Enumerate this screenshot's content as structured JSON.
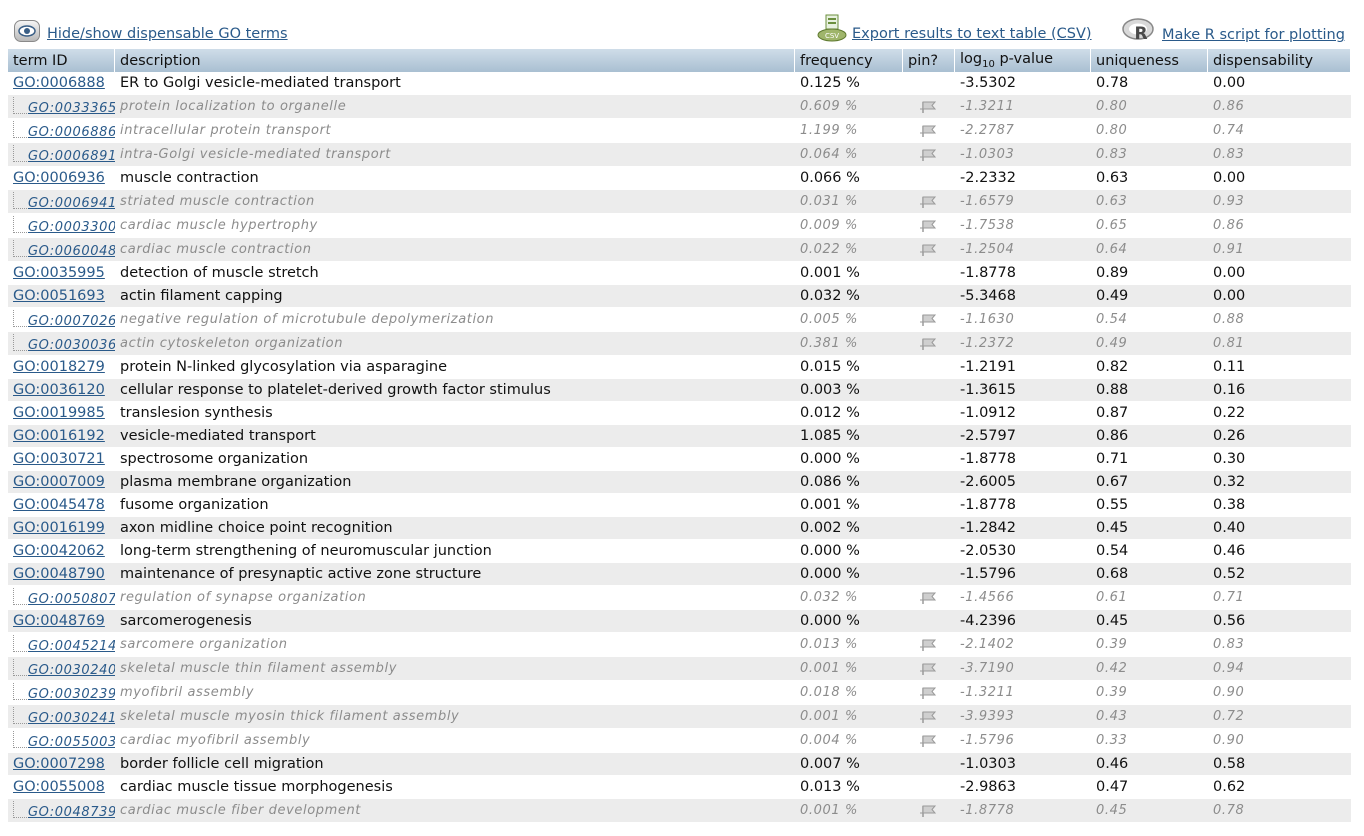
{
  "toolbar": {
    "hide_show_label": "Hide/show dispensable GO terms",
    "export_csv_label": "Export results to text table (CSV)",
    "r_script_label": "Make R script for plotting"
  },
  "table": {
    "headers": {
      "term_id": "term ID",
      "description": "description",
      "frequency": "frequency",
      "pin": "pin?",
      "pvalue_prefix": "log",
      "pvalue_sub": "10",
      "pvalue_suffix": " p-value",
      "uniqueness": "uniqueness",
      "dispensability": "dispensability"
    },
    "rows": [
      {
        "id": "GO:0006888",
        "desc": "ER to Golgi vesicle-mediated transport",
        "freq": "0.125 %",
        "pval": "-3.5302",
        "uniq": "0.78",
        "disp": "0.00",
        "sub": false
      },
      {
        "id": "GO:0033365",
        "desc": "protein localization to organelle",
        "freq": "0.609 %",
        "pval": "-1.3211",
        "uniq": "0.80",
        "disp": "0.86",
        "sub": true
      },
      {
        "id": "GO:0006886",
        "desc": "intracellular protein transport",
        "freq": "1.199 %",
        "pval": "-2.2787",
        "uniq": "0.80",
        "disp": "0.74",
        "sub": true
      },
      {
        "id": "GO:0006891",
        "desc": "intra-Golgi vesicle-mediated transport",
        "freq": "0.064 %",
        "pval": "-1.0303",
        "uniq": "0.83",
        "disp": "0.83",
        "sub": true
      },
      {
        "id": "GO:0006936",
        "desc": "muscle contraction",
        "freq": "0.066 %",
        "pval": "-2.2332",
        "uniq": "0.63",
        "disp": "0.00",
        "sub": false
      },
      {
        "id": "GO:0006941",
        "desc": "striated muscle contraction",
        "freq": "0.031 %",
        "pval": "-1.6579",
        "uniq": "0.63",
        "disp": "0.93",
        "sub": true
      },
      {
        "id": "GO:0003300",
        "desc": "cardiac muscle hypertrophy",
        "freq": "0.009 %",
        "pval": "-1.7538",
        "uniq": "0.65",
        "disp": "0.86",
        "sub": true
      },
      {
        "id": "GO:0060048",
        "desc": "cardiac muscle contraction",
        "freq": "0.022 %",
        "pval": "-1.2504",
        "uniq": "0.64",
        "disp": "0.91",
        "sub": true
      },
      {
        "id": "GO:0035995",
        "desc": "detection of muscle stretch",
        "freq": "0.001 %",
        "pval": "-1.8778",
        "uniq": "0.89",
        "disp": "0.00",
        "sub": false
      },
      {
        "id": "GO:0051693",
        "desc": "actin filament capping",
        "freq": "0.032 %",
        "pval": "-5.3468",
        "uniq": "0.49",
        "disp": "0.00",
        "sub": false
      },
      {
        "id": "GO:0007026",
        "desc": "negative regulation of microtubule depolymerization",
        "freq": "0.005 %",
        "pval": "-1.1630",
        "uniq": "0.54",
        "disp": "0.88",
        "sub": true
      },
      {
        "id": "GO:0030036",
        "desc": "actin cytoskeleton organization",
        "freq": "0.381 %",
        "pval": "-1.2372",
        "uniq": "0.49",
        "disp": "0.81",
        "sub": true
      },
      {
        "id": "GO:0018279",
        "desc": "protein N-linked glycosylation via asparagine",
        "freq": "0.015 %",
        "pval": "-1.2191",
        "uniq": "0.82",
        "disp": "0.11",
        "sub": false
      },
      {
        "id": "GO:0036120",
        "desc": "cellular response to platelet-derived growth factor stimulus",
        "freq": "0.003 %",
        "pval": "-1.3615",
        "uniq": "0.88",
        "disp": "0.16",
        "sub": false
      },
      {
        "id": "GO:0019985",
        "desc": "translesion synthesis",
        "freq": "0.012 %",
        "pval": "-1.0912",
        "uniq": "0.87",
        "disp": "0.22",
        "sub": false
      },
      {
        "id": "GO:0016192",
        "desc": "vesicle-mediated transport",
        "freq": "1.085 %",
        "pval": "-2.5797",
        "uniq": "0.86",
        "disp": "0.26",
        "sub": false
      },
      {
        "id": "GO:0030721",
        "desc": "spectrosome organization",
        "freq": "0.000 %",
        "pval": "-1.8778",
        "uniq": "0.71",
        "disp": "0.30",
        "sub": false
      },
      {
        "id": "GO:0007009",
        "desc": "plasma membrane organization",
        "freq": "0.086 %",
        "pval": "-2.6005",
        "uniq": "0.67",
        "disp": "0.32",
        "sub": false
      },
      {
        "id": "GO:0045478",
        "desc": "fusome organization",
        "freq": "0.001 %",
        "pval": "-1.8778",
        "uniq": "0.55",
        "disp": "0.38",
        "sub": false
      },
      {
        "id": "GO:0016199",
        "desc": "axon midline choice point recognition",
        "freq": "0.002 %",
        "pval": "-1.2842",
        "uniq": "0.45",
        "disp": "0.40",
        "sub": false
      },
      {
        "id": "GO:0042062",
        "desc": "long-term strengthening of neuromuscular junction",
        "freq": "0.000 %",
        "pval": "-2.0530",
        "uniq": "0.54",
        "disp": "0.46",
        "sub": false
      },
      {
        "id": "GO:0048790",
        "desc": "maintenance of presynaptic active zone structure",
        "freq": "0.000 %",
        "pval": "-1.5796",
        "uniq": "0.68",
        "disp": "0.52",
        "sub": false
      },
      {
        "id": "GO:0050807",
        "desc": "regulation of synapse organization",
        "freq": "0.032 %",
        "pval": "-1.4566",
        "uniq": "0.61",
        "disp": "0.71",
        "sub": true
      },
      {
        "id": "GO:0048769",
        "desc": "sarcomerogenesis",
        "freq": "0.000 %",
        "pval": "-4.2396",
        "uniq": "0.45",
        "disp": "0.56",
        "sub": false
      },
      {
        "id": "GO:0045214",
        "desc": "sarcomere organization",
        "freq": "0.013 %",
        "pval": "-2.1402",
        "uniq": "0.39",
        "disp": "0.83",
        "sub": true
      },
      {
        "id": "GO:0030240",
        "desc": "skeletal muscle thin filament assembly",
        "freq": "0.001 %",
        "pval": "-3.7190",
        "uniq": "0.42",
        "disp": "0.94",
        "sub": true
      },
      {
        "id": "GO:0030239",
        "desc": "myofibril assembly",
        "freq": "0.018 %",
        "pval": "-1.3211",
        "uniq": "0.39",
        "disp": "0.90",
        "sub": true
      },
      {
        "id": "GO:0030241",
        "desc": "skeletal muscle myosin thick filament assembly",
        "freq": "0.001 %",
        "pval": "-3.9393",
        "uniq": "0.43",
        "disp": "0.72",
        "sub": true
      },
      {
        "id": "GO:0055003",
        "desc": "cardiac myofibril assembly",
        "freq": "0.004 %",
        "pval": "-1.5796",
        "uniq": "0.33",
        "disp": "0.90",
        "sub": true
      },
      {
        "id": "GO:0007298",
        "desc": "border follicle cell migration",
        "freq": "0.007 %",
        "pval": "-1.0303",
        "uniq": "0.46",
        "disp": "0.58",
        "sub": false
      },
      {
        "id": "GO:0055008",
        "desc": "cardiac muscle tissue morphogenesis",
        "freq": "0.013 %",
        "pval": "-2.9863",
        "uniq": "0.47",
        "disp": "0.62",
        "sub": false
      },
      {
        "id": "GO:0048739",
        "desc": "cardiac muscle fiber development",
        "freq": "0.001 %",
        "pval": "-1.8778",
        "uniq": "0.45",
        "disp": "0.78",
        "sub": true
      }
    ]
  }
}
